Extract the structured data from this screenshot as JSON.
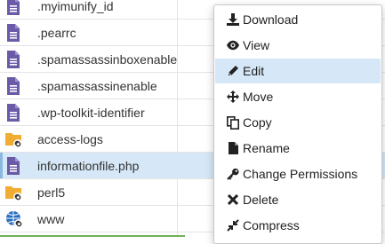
{
  "files": [
    {
      "name": ".myimunify_id",
      "icon": "file-icon",
      "selected": false
    },
    {
      "name": ".pearrc",
      "icon": "file-icon",
      "selected": false
    },
    {
      "name": ".spamassassinboxenable",
      "icon": "file-icon",
      "selected": false
    },
    {
      "name": ".spamassassinenable",
      "icon": "file-icon",
      "selected": false
    },
    {
      "name": ".wp-toolkit-identifier",
      "icon": "file-icon",
      "selected": false
    },
    {
      "name": "access-logs",
      "icon": "folder-link-icon",
      "selected": false
    },
    {
      "name": "informationfile.php",
      "icon": "file-icon",
      "selected": true
    },
    {
      "name": "perl5",
      "icon": "folder-link-icon",
      "selected": false
    },
    {
      "name": "www",
      "icon": "globe-link-icon",
      "selected": false
    }
  ],
  "context_menu": {
    "items": [
      {
        "label": "Download",
        "icon": "download-icon"
      },
      {
        "label": "View",
        "icon": "eye-icon"
      },
      {
        "label": "Edit",
        "icon": "pencil-icon",
        "hovered": true
      },
      {
        "label": "Move",
        "icon": "move-arrows-icon"
      },
      {
        "label": "Copy",
        "icon": "copy-icon"
      },
      {
        "label": "Rename",
        "icon": "file-rename-icon"
      },
      {
        "label": "Change Permissions",
        "icon": "key-icon"
      },
      {
        "label": "Delete",
        "icon": "close-x-icon"
      },
      {
        "label": "Compress",
        "icon": "compress-icon"
      }
    ]
  },
  "colors": {
    "file_icon": "#6a5aa8",
    "folder_icon": "#f0ad32",
    "globe_icon": "#2a6fc2",
    "selection": "#d6e8f7"
  }
}
